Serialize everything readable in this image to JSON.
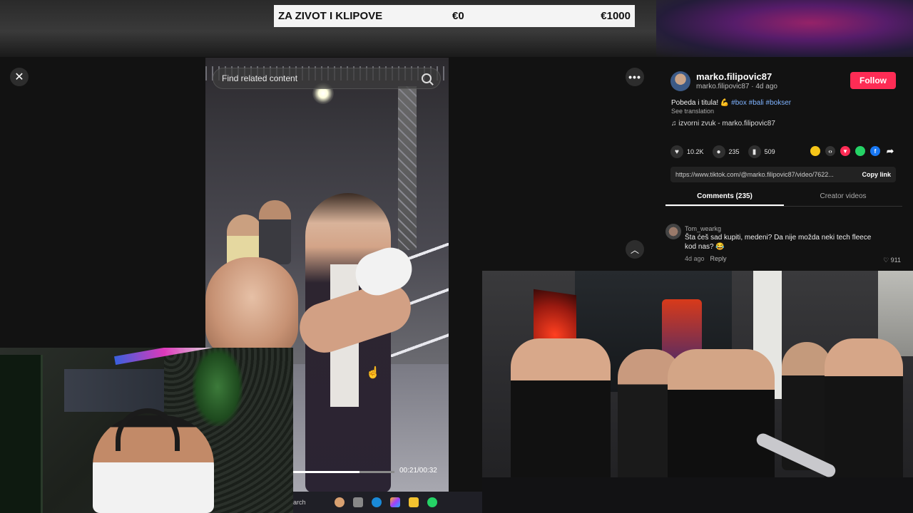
{
  "banner": {
    "title": "ZA ZIVOT I KLIPOVE",
    "amount_start": "€0",
    "amount_goal": "€1000"
  },
  "video": {
    "search_placeholder": "Find related content",
    "time": "00:21/00:32",
    "progress": 0.66
  },
  "controls": {
    "close_glyph": "✕",
    "more_glyph": "•••",
    "up_glyph": "︿"
  },
  "post": {
    "username": "marko.filipovic87",
    "subline": "marko.filipovic87 · 4d ago",
    "follow_label": "Follow",
    "caption_text": "Pobeda i titula! 💪",
    "hashtags": "#box #bali #bokser",
    "see_translation": "See translation",
    "sound": "♫  izvorni zvuk - marko.filipovic87",
    "likes": "10.2K",
    "comments_count": "235",
    "saves": "509",
    "link_url": "https://www.tiktok.com/@marko.filipovic87/video/7622...",
    "copy_link": "Copy link"
  },
  "tabs": [
    {
      "label": "Comments (235)",
      "active": true
    },
    {
      "label": "Creator videos",
      "active": false
    }
  ],
  "comment": {
    "user": "Tom_wearkg",
    "text": "Šta ćeš sad kupiti, medeni? Da nije možda neki tech fleece kod nas? 😂",
    "time": "4d ago",
    "reply": "Reply",
    "likes": "♡ 911"
  },
  "taskbar": {
    "search_text": "arch"
  },
  "icons": {
    "heart": "heart-icon",
    "comment": "comment-icon",
    "bookmark": "bookmark-icon",
    "share": "share-arrow-icon"
  },
  "colors": {
    "follow": "#fe2c55",
    "hashtag": "#7fb3ff",
    "panel_bg": "#121212"
  }
}
